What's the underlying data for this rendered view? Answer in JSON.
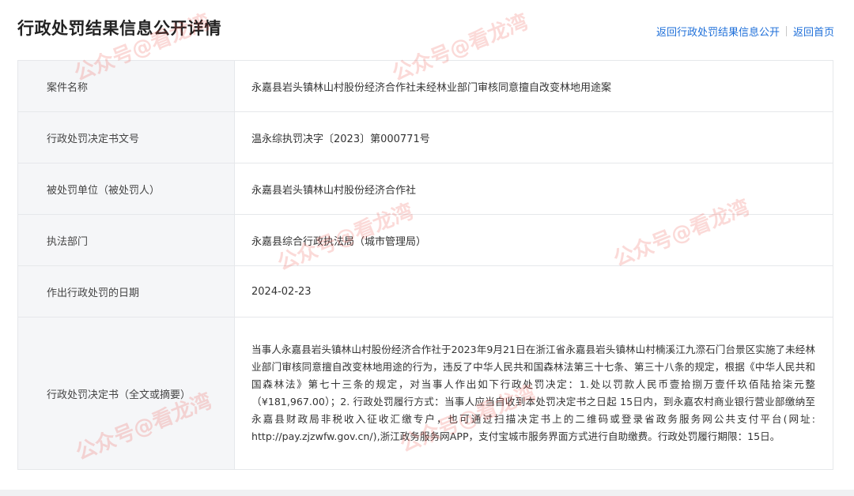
{
  "header": {
    "title": "行政处罚结果信息公开详情",
    "links": [
      {
        "label": "返回行政处罚结果信息公开"
      },
      {
        "label": "返回首页"
      }
    ]
  },
  "rows": [
    {
      "label": "案件名称",
      "value": "永嘉县岩头镇林山村股份经济合作社未经林业部门审核同意擅自改变林地用途案"
    },
    {
      "label": "行政处罚决定书文号",
      "value": "温永综执罚决字〔2023〕第000771号"
    },
    {
      "label": "被处罚单位（被处罚人）",
      "value": "永嘉县岩头镇林山村股份经济合作社"
    },
    {
      "label": "执法部门",
      "value": "永嘉县综合行政执法局（城市管理局）"
    },
    {
      "label": "作出行政处罚的日期",
      "value": "2024-02-23"
    },
    {
      "label": "行政处罚决定书（全文或摘要）",
      "value": "当事人永嘉县岩头镇林山村股份经济合作社于2023年9月21日在浙江省永嘉县岩头镇林山村楠溪江九漈石门台景区实施了未经林业部门审核同意擅自改变林地用途的行为，违反了中华人民共和国森林法第三十七条、第三十八条的规定，根据《中华人民共和国森林法》第七十三条的规定，对当事人作出如下行政处罚决定：1.处以罚款人民币壹拾捌万壹仟玖佰陆拾柒元整（¥181,967.00）；2. 行政处罚履行方式：当事人应当自收到本处罚决定书之日起 15日内，到永嘉农村商业银行营业部缴纳至永嘉县财政局非税收入征收汇缴专户，也可通过扫描决定书上的二维码或登录省政务服务网公共支付平台(网址: http://pay.zjzwfw.gov.cn/),浙江政务服务网APP，支付宝城市服务界面方式进行自助缴费。行政处罚履行期限：15日。"
    }
  ],
  "watermark": "公众号@看龙湾"
}
